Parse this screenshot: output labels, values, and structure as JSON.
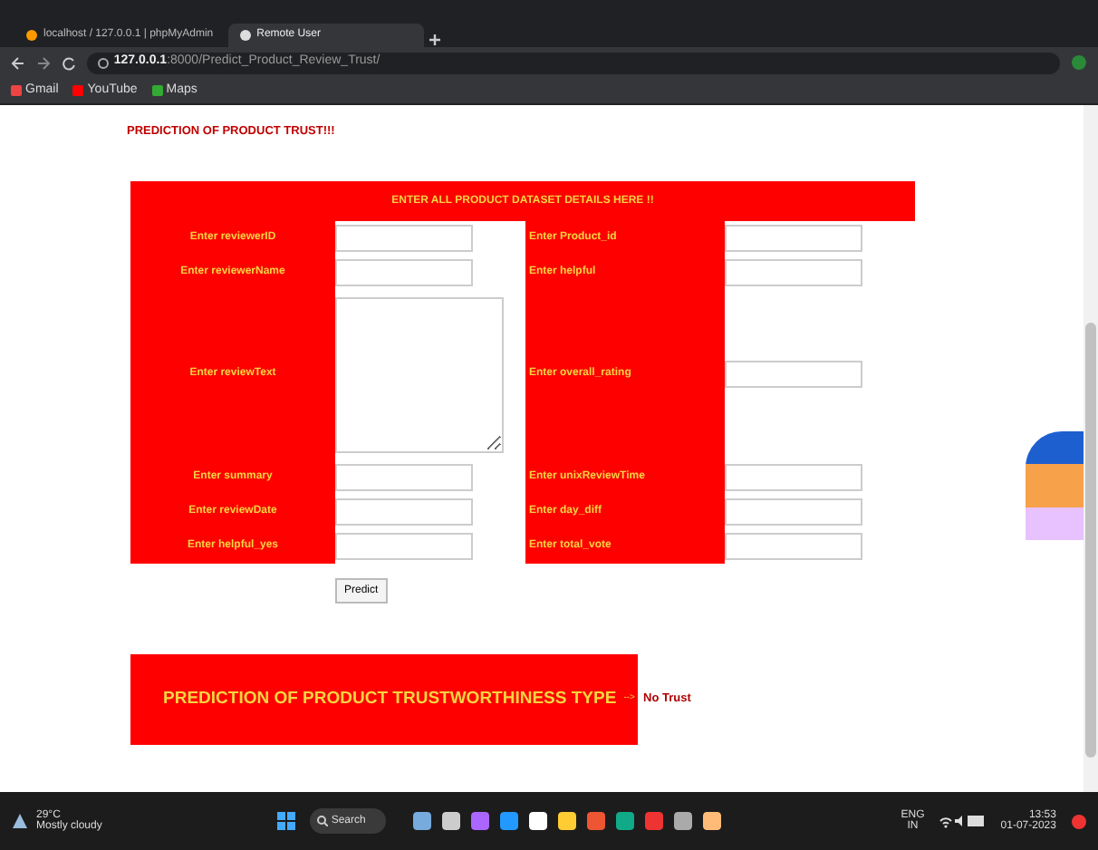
{
  "browser": {
    "tabs": [
      {
        "title": "localhost / 127.0.0.1 | phpMyAdmin",
        "selected": false
      },
      {
        "title": "Remote User",
        "selected": true
      }
    ],
    "url_host": "127.0.0.1",
    "url_path": ":8000/Predict_Product_Review_Trust/",
    "bookmarks": [
      "Gmail",
      "YouTube",
      "Maps"
    ]
  },
  "page": {
    "heading": "PREDICTION OF PRODUCT TRUST!!!",
    "form": {
      "header": "ENTER ALL PRODUCT DATASET DETAILS HERE !!",
      "rows": [
        {
          "left": {
            "label": "Enter reviewerID",
            "kind": "input"
          },
          "right": {
            "label": "Enter Product_id",
            "kind": "input"
          }
        },
        {
          "left": {
            "label": "Enter reviewerName",
            "kind": "input"
          },
          "right": {
            "label": "Enter helpful",
            "kind": "input"
          }
        },
        {
          "left": {
            "label": "Enter reviewText",
            "kind": "textarea"
          },
          "right": {
            "label": "Enter overall_rating",
            "kind": "input"
          }
        },
        {
          "left": {
            "label": "Enter summary",
            "kind": "input"
          },
          "right": {
            "label": "Enter unixReviewTime",
            "kind": "input"
          }
        },
        {
          "left": {
            "label": "Enter reviewDate",
            "kind": "input"
          },
          "right": {
            "label": "Enter day_diff",
            "kind": "input"
          }
        },
        {
          "left": {
            "label": "Enter helpful_yes",
            "kind": "input"
          },
          "right": {
            "label": "Enter total_vote",
            "kind": "input"
          }
        }
      ],
      "button": "Predict"
    },
    "result": {
      "label": "PREDICTION OF PRODUCT TRUSTWORTHINESS TYPE",
      "arrow": "-->",
      "value": "No Trust"
    }
  },
  "taskbar": {
    "temperature": "29°C",
    "weather": "Mostly cloudy",
    "search": "Search",
    "language": "ENG",
    "region": "IN",
    "time": "13:53",
    "date": "01-07-2023"
  }
}
